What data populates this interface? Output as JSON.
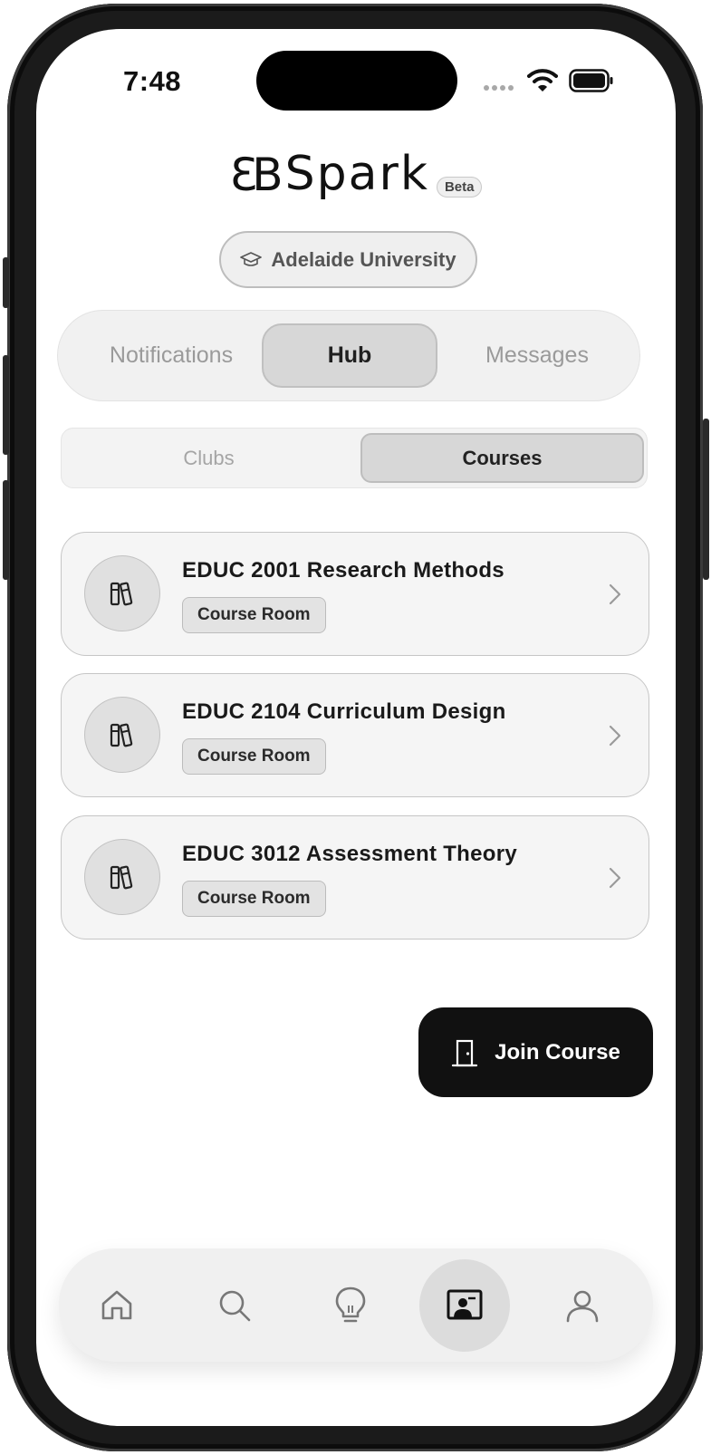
{
  "status_bar": {
    "time": "7:48"
  },
  "header": {
    "logo_mark": "ƐB",
    "app_name": "Spark",
    "badge": "Beta"
  },
  "university": {
    "icon": "graduation-cap-icon",
    "label": "Adelaide University"
  },
  "main_tabs": [
    {
      "label": "Notifications",
      "active": false
    },
    {
      "label": "Hub",
      "active": true
    },
    {
      "label": "Messages",
      "active": false
    }
  ],
  "sub_tabs": [
    {
      "label": "Clubs",
      "active": false
    },
    {
      "label": "Courses",
      "active": true
    }
  ],
  "courses": [
    {
      "title": "EDUC 2001 Research Methods",
      "badge": "Course Room",
      "icon": "books-icon"
    },
    {
      "title": "EDUC 2104 Curriculum Design",
      "badge": "Course Room",
      "icon": "books-icon"
    },
    {
      "title": "EDUC 3012 Assessment Theory",
      "badge": "Course Room",
      "icon": "books-icon"
    }
  ],
  "join_button": {
    "label": "Join Course",
    "icon": "door-icon"
  },
  "bottom_nav": [
    {
      "icon": "home-icon",
      "active": false
    },
    {
      "icon": "search-icon",
      "active": false
    },
    {
      "icon": "lightbulb-icon",
      "active": false
    },
    {
      "icon": "classroom-icon",
      "active": true
    },
    {
      "icon": "profile-icon",
      "active": false
    }
  ],
  "colors": {
    "primary_button": "#111111",
    "active_tab": "#d7d7d7",
    "card_bg": "#f5f5f5"
  }
}
